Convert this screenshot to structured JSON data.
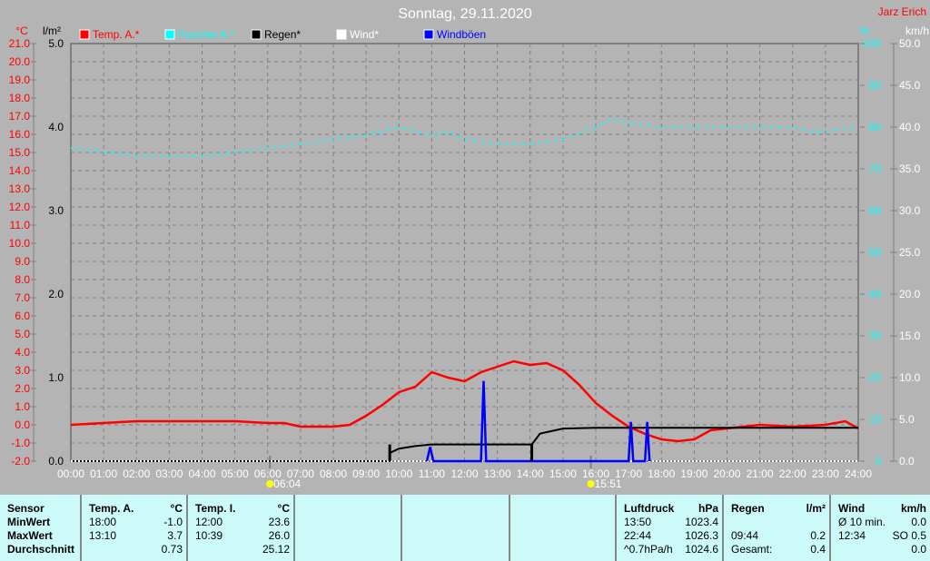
{
  "chart_data": {
    "type": "line",
    "title": "Sonntag, 29.11.2020",
    "author": "Jarz Erich",
    "legend": [
      {
        "name": "Temp. A.*",
        "color": "#ff0000"
      },
      {
        "name": "Feuchte A.*",
        "color": "#00ffff"
      },
      {
        "name": "Regen*",
        "color": "#000000"
      },
      {
        "name": "Wind*",
        "color": "#ffffff"
      },
      {
        "name": "Windböen",
        "color": "#0000ff"
      }
    ],
    "axes": {
      "temp": {
        "unit": "°C",
        "min": -2,
        "max": 21,
        "step": 1,
        "color": "#ff0000"
      },
      "rain": {
        "unit": "l/m²",
        "min": 0,
        "max": 5,
        "step": 1,
        "color": "#000000"
      },
      "humidity": {
        "unit": "%",
        "min": 0,
        "max": 100,
        "step": 10,
        "color": "#00ffff"
      },
      "wind": {
        "unit": "km/h",
        "min": 0,
        "max": 50,
        "step": 5,
        "color": "#ffffff"
      }
    },
    "x_ticks": [
      "00:00",
      "01:00",
      "02:00",
      "03:00",
      "04:00",
      "05:00",
      "06:00",
      "07:00",
      "08:00",
      "09:00",
      "10:00",
      "11:00",
      "12:00",
      "13:00",
      "14:00",
      "15:00",
      "16:00",
      "17:00",
      "18:00",
      "19:00",
      "20:00",
      "21:00",
      "22:00",
      "23:00",
      "24:00"
    ],
    "sunrise": "06:04",
    "sunset": "15:51",
    "grid": true,
    "series": [
      {
        "name": "Temp. A.*",
        "axis": "temp",
        "points": [
          [
            0,
            0.0
          ],
          [
            1,
            0.1
          ],
          [
            2,
            0.2
          ],
          [
            3,
            0.2
          ],
          [
            4,
            0.2
          ],
          [
            5,
            0.2
          ],
          [
            6,
            0.1
          ],
          [
            6.5,
            0.1
          ],
          [
            7,
            -0.1
          ],
          [
            8,
            -0.1
          ],
          [
            8.5,
            0.0
          ],
          [
            9,
            0.5
          ],
          [
            9.5,
            1.1
          ],
          [
            10,
            1.8
          ],
          [
            10.5,
            2.1
          ],
          [
            11,
            2.9
          ],
          [
            11.5,
            2.6
          ],
          [
            12,
            2.4
          ],
          [
            12.5,
            2.9
          ],
          [
            13,
            3.2
          ],
          [
            13.5,
            3.5
          ],
          [
            14,
            3.3
          ],
          [
            14.5,
            3.4
          ],
          [
            15,
            3.0
          ],
          [
            15.5,
            2.2
          ],
          [
            16,
            1.2
          ],
          [
            16.5,
            0.5
          ],
          [
            17,
            -0.1
          ],
          [
            17.5,
            -0.5
          ],
          [
            18,
            -0.8
          ],
          [
            18.5,
            -0.9
          ],
          [
            19,
            -0.8
          ],
          [
            19.5,
            -0.3
          ],
          [
            20,
            -0.2
          ],
          [
            21,
            0.0
          ],
          [
            22,
            -0.1
          ],
          [
            23,
            0.0
          ],
          [
            23.6,
            0.2
          ],
          [
            24,
            -0.2
          ]
        ]
      },
      {
        "name": "Feuchte A.*",
        "axis": "humidity",
        "points": [
          [
            0,
            75
          ],
          [
            1,
            74
          ],
          [
            2,
            73
          ],
          [
            3,
            73
          ],
          [
            4,
            73
          ],
          [
            5,
            74
          ],
          [
            6,
            75
          ],
          [
            7,
            76
          ],
          [
            8,
            77
          ],
          [
            9,
            78
          ],
          [
            10,
            80
          ],
          [
            10.5,
            79
          ],
          [
            11,
            78
          ],
          [
            11.5,
            79
          ],
          [
            12,
            77
          ],
          [
            13,
            76
          ],
          [
            14,
            76
          ],
          [
            15,
            77
          ],
          [
            16,
            80
          ],
          [
            16.5,
            82
          ],
          [
            17,
            81
          ],
          [
            18,
            80
          ],
          [
            19,
            80
          ],
          [
            20,
            80
          ],
          [
            21,
            80
          ],
          [
            22,
            80
          ],
          [
            22.5,
            79
          ],
          [
            23,
            79
          ],
          [
            23.9,
            80
          ]
        ]
      },
      {
        "name": "Regen*",
        "axis": "rain",
        "points": [
          [
            0,
            0
          ],
          [
            9.72,
            0
          ],
          [
            9.73,
            0.1
          ],
          [
            10,
            0.15
          ],
          [
            10.5,
            0.18
          ],
          [
            11,
            0.2
          ],
          [
            14.05,
            0.2
          ],
          [
            14.3,
            0.33
          ],
          [
            15,
            0.39
          ],
          [
            16,
            0.4
          ],
          [
            24,
            0.4
          ]
        ]
      },
      {
        "name": "Wind*",
        "axis": "wind",
        "points": [
          [
            0,
            0
          ],
          [
            24,
            0
          ]
        ]
      },
      {
        "name": "Windböen",
        "axis": "wind",
        "points": [
          [
            10.85,
            0
          ],
          [
            10.95,
            1.7
          ],
          [
            11.05,
            0
          ],
          [
            12.5,
            0
          ],
          [
            12.58,
            9.6
          ],
          [
            12.66,
            0
          ],
          [
            17.0,
            0
          ],
          [
            17.07,
            4.7
          ],
          [
            17.14,
            0
          ],
          [
            17.5,
            0
          ],
          [
            17.57,
            4.7
          ],
          [
            17.64,
            0
          ]
        ]
      }
    ]
  },
  "table": {
    "sensor": {
      "header": "Sensor",
      "rows": [
        "MinWert",
        "MaxWert",
        "Durchschnitt"
      ]
    },
    "temp_a": {
      "header": "Temp. A.",
      "unit": "°C",
      "rows": [
        [
          "18:00",
          "-1.0"
        ],
        [
          "13:10",
          "3.7"
        ],
        [
          "",
          "0.73"
        ]
      ]
    },
    "temp_i": {
      "header": "Temp. I.",
      "unit": "°C",
      "rows": [
        [
          "12:00",
          "23.6"
        ],
        [
          "10:39",
          "26.0"
        ],
        [
          "",
          "25.12"
        ]
      ]
    },
    "pressure": {
      "header": "Luftdruck",
      "unit": "hPa",
      "rows": [
        [
          "13:50",
          "1023.4"
        ],
        [
          "22:44",
          "1026.3"
        ],
        [
          "^0.7hPa/h",
          "1024.6"
        ]
      ]
    },
    "rain": {
      "header": "Regen",
      "unit": "l/m²",
      "rows": [
        [
          "",
          ""
        ],
        [
          "09:44",
          "0.2"
        ],
        [
          "Gesamt:",
          "0.4"
        ]
      ]
    },
    "wind": {
      "header": "Wind",
      "unit": "km/h",
      "rows": [
        [
          "Ø 10 min.",
          "0.0"
        ],
        [
          "12:34",
          "SO 0.5"
        ],
        [
          "",
          "0.0"
        ]
      ]
    }
  }
}
